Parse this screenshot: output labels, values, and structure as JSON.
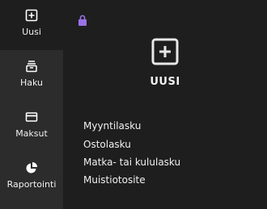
{
  "sidebar": {
    "items": [
      {
        "label": "Uusi",
        "icon": "add-box-icon"
      },
      {
        "label": "Haku",
        "icon": "archive-icon"
      },
      {
        "label": "Maksut",
        "icon": "credit-card-icon"
      },
      {
        "label": "Raportointi",
        "icon": "pie-chart-icon"
      }
    ]
  },
  "main": {
    "title": "UUSI",
    "options": [
      "Myyntilasku",
      "Ostolasku",
      "Matka- tai kululasku",
      "Muistiotosite"
    ]
  },
  "colors": {
    "accent": "#9b72e8",
    "sidebar_bg": "#2c2c2c",
    "main_bg": "#1e1e1e",
    "text": "#f0f0f0"
  }
}
